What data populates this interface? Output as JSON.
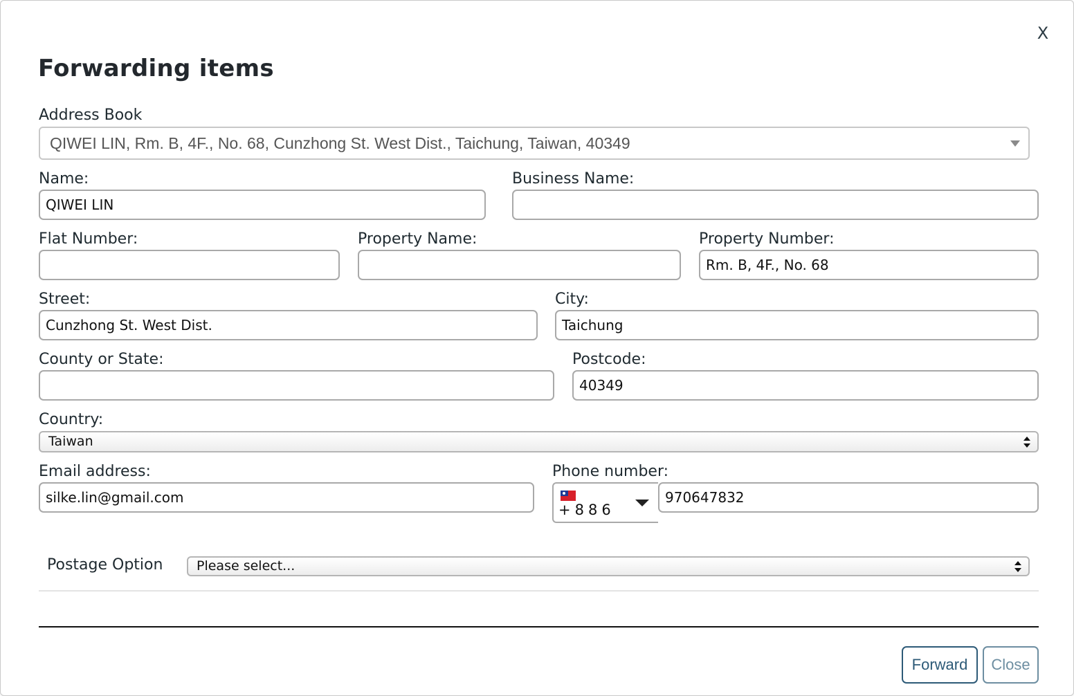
{
  "dialog": {
    "title": "Forwarding items",
    "close_label": "X"
  },
  "address_book": {
    "label": "Address Book",
    "selected": "QIWEI LIN, Rm. B, 4F., No. 68, Cunzhong St. West Dist., Taichung, Taiwan, 40349"
  },
  "fields": {
    "name": {
      "label": "Name:",
      "value": "QIWEI LIN"
    },
    "business_name": {
      "label": "Business Name:",
      "value": ""
    },
    "flat_number": {
      "label": "Flat Number:",
      "value": ""
    },
    "property_name": {
      "label": "Property Name:",
      "value": ""
    },
    "property_number": {
      "label": "Property Number:",
      "value": "Rm. B, 4F., No. 68"
    },
    "street": {
      "label": "Street:",
      "value": "Cunzhong St. West Dist."
    },
    "city": {
      "label": "City:",
      "value": "Taichung"
    },
    "county": {
      "label": "County or State:",
      "value": ""
    },
    "postcode": {
      "label": "Postcode:",
      "value": "40349"
    },
    "country": {
      "label": "Country:",
      "value": "Taiwan"
    },
    "email": {
      "label": "Email address:",
      "value": "silke.lin@gmail.com"
    },
    "phone": {
      "label": "Phone number:",
      "country_code": "+886",
      "flag_icon": "taiwan-flag-icon",
      "value": "970647832"
    }
  },
  "postage": {
    "label": "Postage Option",
    "selected": "Please select..."
  },
  "buttons": {
    "forward": "Forward",
    "close": "Close"
  },
  "colors": {
    "forward_border": "#2d5a77",
    "close_border": "#6d8ea1",
    "taiwan_flag_red": "#d8202a",
    "taiwan_flag_blue": "#1f3a93"
  }
}
